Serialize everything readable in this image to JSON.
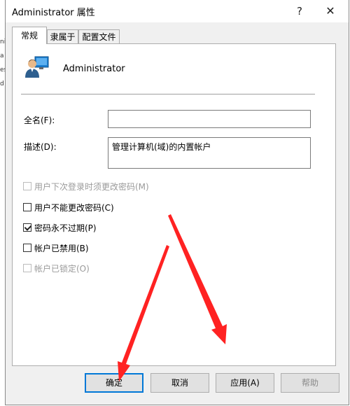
{
  "background_window": {
    "edge_fragments": [
      "ni",
      "a",
      "es",
      "d"
    ]
  },
  "dialog": {
    "title": "Administrator 属性",
    "help_glyph": "?",
    "close_glyph": "✕"
  },
  "tabs": [
    {
      "label": "常规",
      "active": true
    },
    {
      "label": "隶属于",
      "active": false
    },
    {
      "label": "配置文件",
      "active": false
    }
  ],
  "general": {
    "user_name": "Administrator",
    "fullname_label": "全名(F):",
    "fullname_value": "",
    "description_label": "描述(D):",
    "description_value": "管理计算机(域)的内置帐户",
    "checkboxes": [
      {
        "label": "用户下次登录时须更改密码(M)",
        "checked": false,
        "enabled": false
      },
      {
        "label": "用户不能更改密码(C)",
        "checked": false,
        "enabled": true
      },
      {
        "label": "密码永不过期(P)",
        "checked": true,
        "enabled": true
      },
      {
        "label": "帐户已禁用(B)",
        "checked": false,
        "enabled": true
      },
      {
        "label": "帐户已锁定(O)",
        "checked": false,
        "enabled": false
      }
    ]
  },
  "buttons": {
    "ok": "确定",
    "cancel": "取消",
    "apply": "应用(A)",
    "help": "帮助"
  },
  "colors": {
    "annotation_arrow": "#ff2222",
    "focus_border": "#0078d7"
  }
}
